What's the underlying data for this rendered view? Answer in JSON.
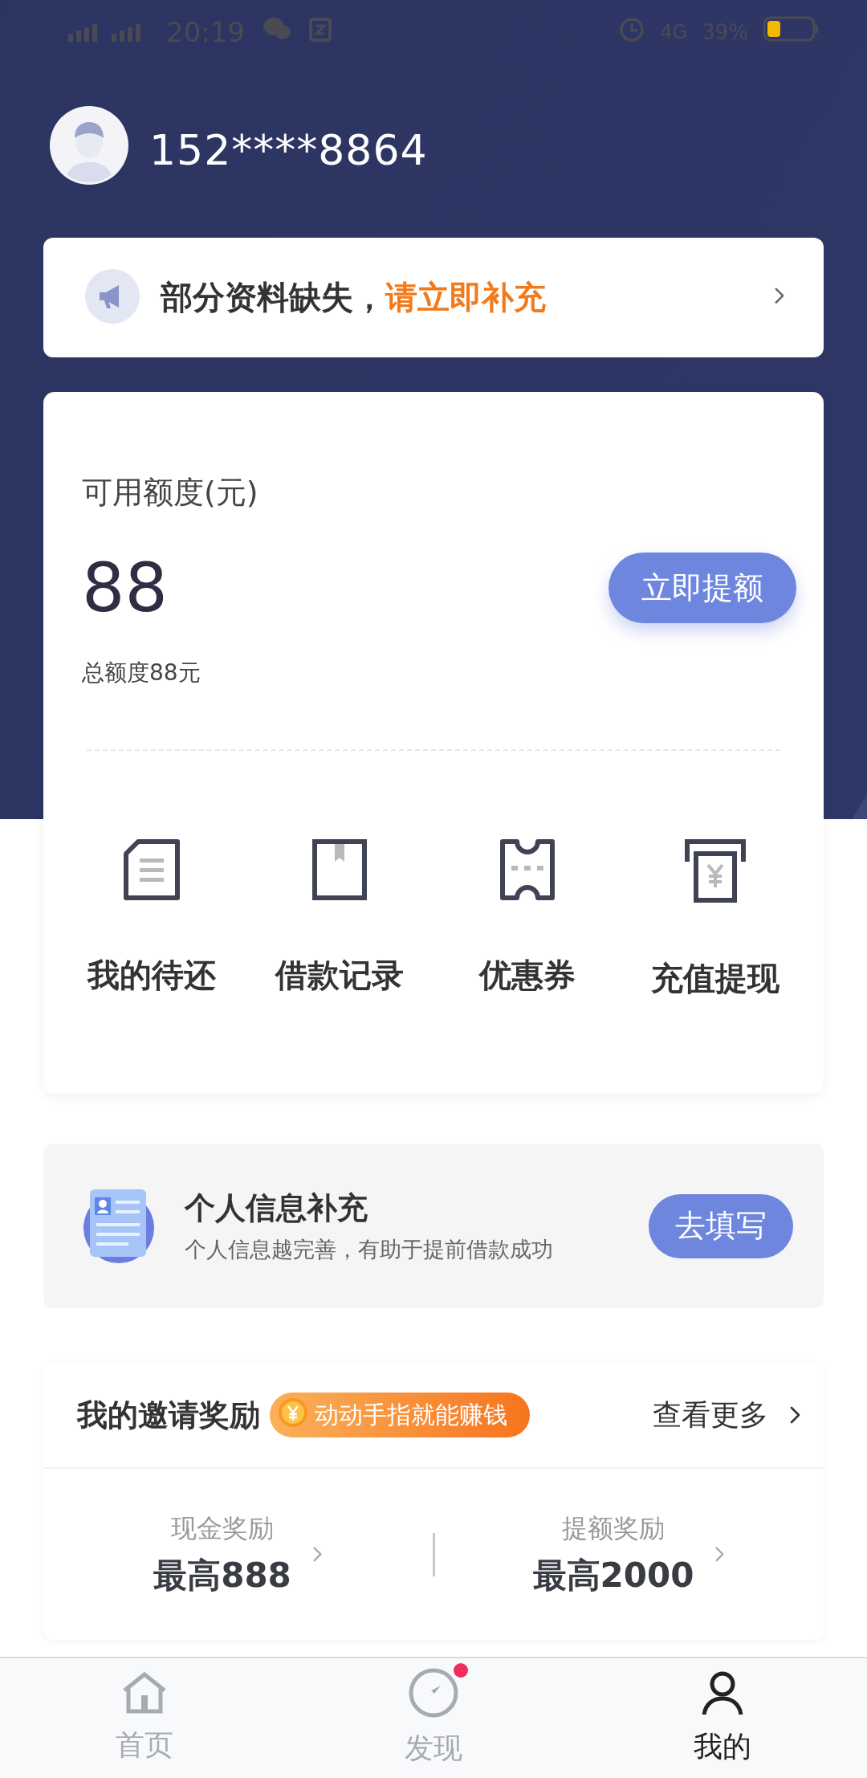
{
  "status_bar": {
    "time": "20:19",
    "network": "4G",
    "battery": "39%"
  },
  "profile": {
    "phone": "152****8864"
  },
  "notice": {
    "text": "部分资料缺失，**请立即补充**"
  },
  "credit": {
    "label": "可用额度(元)",
    "amount": "88",
    "button": "立即提额",
    "total": "总额度88元",
    "actions": [
      {
        "kind": "bill",
        "label": "我的待还"
      },
      {
        "kind": "record",
        "label": "借款记录"
      },
      {
        "kind": "coupon",
        "label": "优惠券"
      },
      {
        "kind": "withdraw",
        "label": "充值提现"
      }
    ]
  },
  "info_card": {
    "title": "个人信息补充",
    "subtitle": "个人信息越完善，有助于提前借款成功",
    "button": "去填写"
  },
  "invite": {
    "title": "我的邀请奖励",
    "badge": "动动手指就能赚钱",
    "more": "查看更多",
    "rewards": [
      {
        "label": "现金奖励",
        "value": "最高888"
      },
      {
        "label": "提额奖励",
        "value": "最高2000"
      }
    ]
  },
  "nav": [
    {
      "kind": "home",
      "label": "首页",
      "selected": false,
      "badge": false
    },
    {
      "kind": "discover",
      "label": "发现",
      "selected": false,
      "badge": true
    },
    {
      "kind": "me",
      "label": "我的",
      "selected": true,
      "badge": false
    }
  ]
}
